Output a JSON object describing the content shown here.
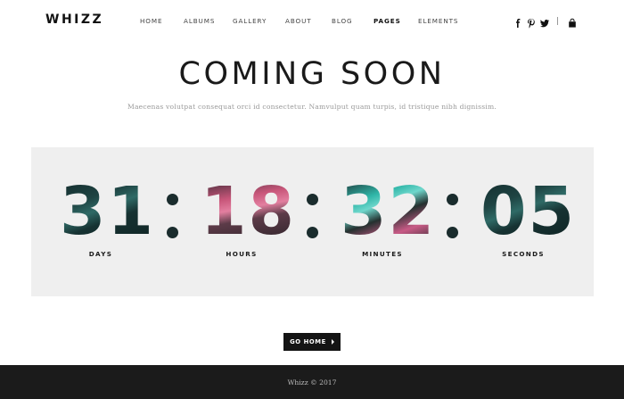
{
  "header": {
    "logo": "WHIZZ",
    "nav": [
      {
        "label": "HOME",
        "active": false
      },
      {
        "label": "ALBUMS",
        "active": false
      },
      {
        "label": "GALLERY",
        "active": false
      },
      {
        "label": "ABOUT",
        "active": false
      },
      {
        "label": "BLOG",
        "active": false
      },
      {
        "label": "PAGES",
        "active": true
      },
      {
        "label": "ELEMENTS",
        "active": false
      }
    ],
    "social_icons": [
      "facebook-icon",
      "pinterest-icon",
      "twitter-icon"
    ],
    "cart_icon": "shopping-bag-icon"
  },
  "hero": {
    "title": "COMING SOON",
    "subtitle": "Maecenas volutpat consequat orci id consectetur. Namvulput quam turpis, id tristique nibh dignissim."
  },
  "countdown": {
    "days": "31",
    "hours": "18",
    "minutes": "32",
    "seconds": "05",
    "labels": {
      "days": "DAYS",
      "hours": "HOURS",
      "minutes": "MINUTES",
      "seconds": "SECONDS"
    }
  },
  "cta": {
    "label": "GO HOME"
  },
  "footer": {
    "text": "Whizz © 2017"
  },
  "colors": {
    "panel_bg": "#efefef",
    "footer_bg": "#1b1b1b",
    "button_bg": "#141414",
    "digit_dark": "#1a2c2d",
    "digit_pink": "#e37fa0",
    "digit_teal": "#2fb6a8"
  }
}
